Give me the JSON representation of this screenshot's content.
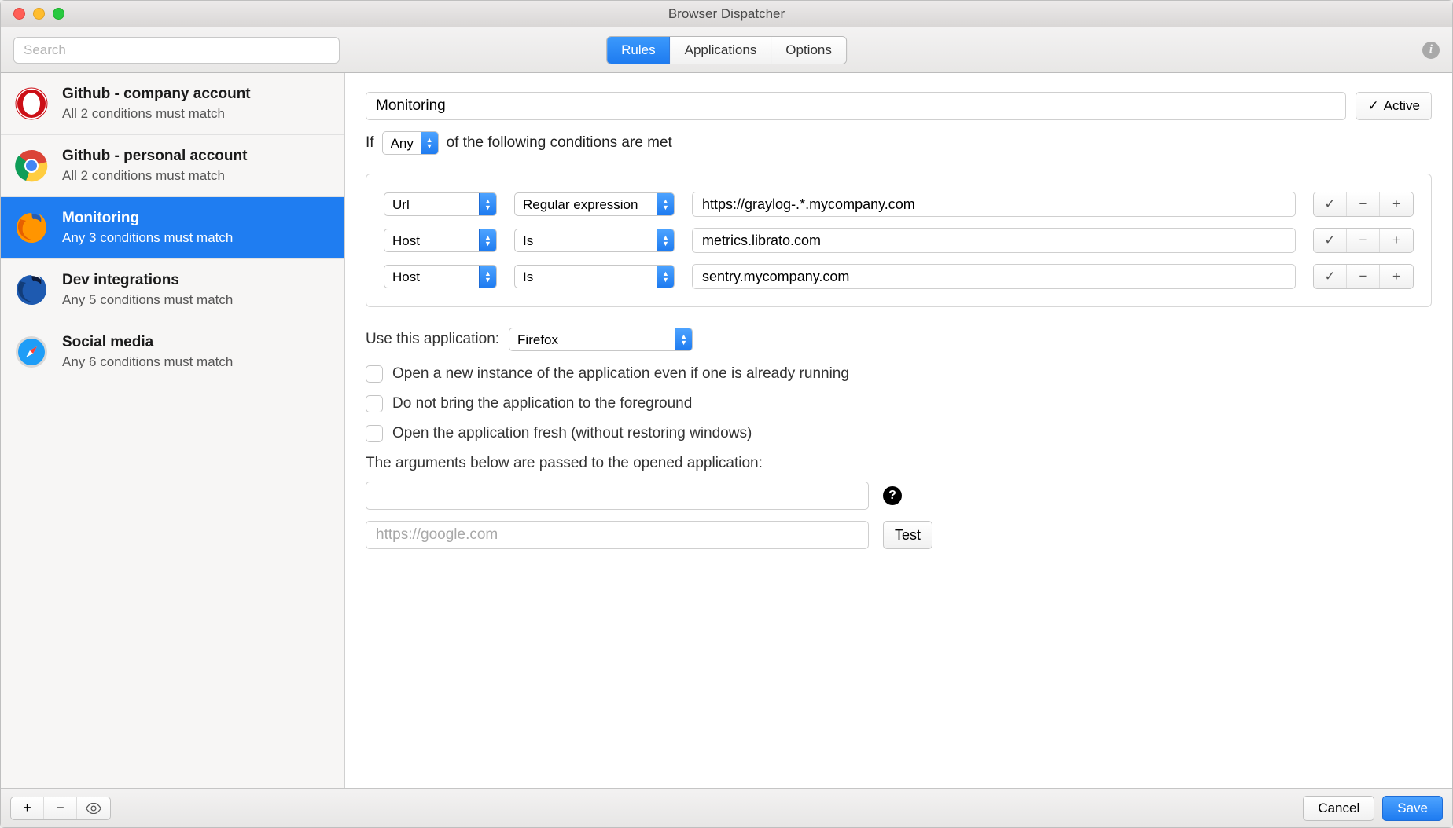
{
  "window": {
    "title": "Browser Dispatcher"
  },
  "toolbar": {
    "search_placeholder": "Search",
    "tabs": [
      "Rules",
      "Applications",
      "Options"
    ],
    "active_tab_index": 0
  },
  "sidebar": {
    "rules": [
      {
        "name": "Github - company account",
        "subtitle": "All 2 conditions must match",
        "browser": "opera"
      },
      {
        "name": "Github - personal account",
        "subtitle": "All 2 conditions must match",
        "browser": "chrome"
      },
      {
        "name": "Monitoring",
        "subtitle": "Any 3 conditions must match",
        "browser": "firefox"
      },
      {
        "name": "Dev integrations",
        "subtitle": "Any 5 conditions must match",
        "browser": "firefox-dev"
      },
      {
        "name": "Social media",
        "subtitle": "Any 6 conditions must match",
        "browser": "safari"
      }
    ],
    "selected_index": 2
  },
  "detail": {
    "rule_name": "Monitoring",
    "active_label": "Active",
    "sentence": {
      "prefix": "If",
      "match_mode": "Any",
      "suffix": "of the following conditions are met"
    },
    "conditions": [
      {
        "field": "Url",
        "operator": "Regular expression",
        "value": "https://graylog-.*.mycompany.com"
      },
      {
        "field": "Host",
        "operator": "Is",
        "value": "metrics.librato.com"
      },
      {
        "field": "Host",
        "operator": "Is",
        "value": "sentry.mycompany.com"
      }
    ],
    "app_label": "Use this application:",
    "app_selected": "Firefox",
    "checkboxes": [
      {
        "label": "Open a new instance of the application even if one is already running",
        "checked": false
      },
      {
        "label": "Do not bring the application to the foreground",
        "checked": false
      },
      {
        "label": "Open the application fresh (without restoring windows)",
        "checked": false
      }
    ],
    "args_label": "The arguments below are passed to the opened application:",
    "args_value": "",
    "test_url_placeholder": "https://google.com",
    "test_label": "Test"
  },
  "footer": {
    "cancel": "Cancel",
    "save": "Save"
  }
}
